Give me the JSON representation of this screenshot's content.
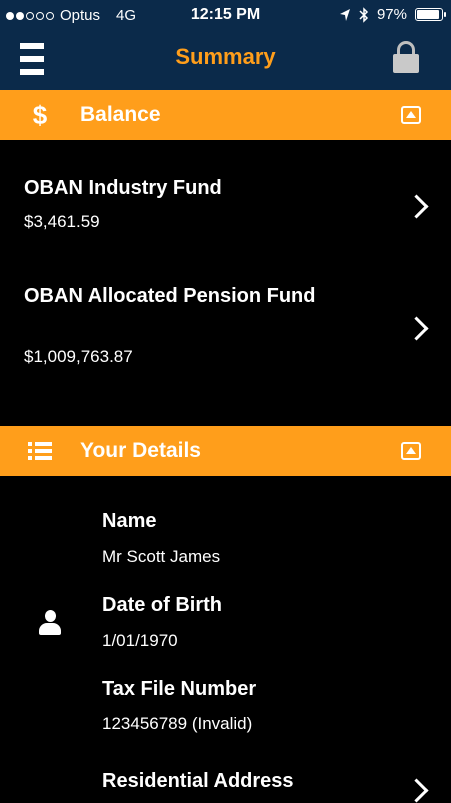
{
  "status_bar": {
    "carrier": "Optus",
    "network": "4G",
    "time": "12:15 PM",
    "battery": "97%",
    "battery_level": 0.97
  },
  "nav": {
    "title": "Summary",
    "menu_icon": "hamburger-icon",
    "lock_icon": "lock-icon"
  },
  "balance_section": {
    "title": "Balance",
    "icon": "dollar-icon",
    "funds": [
      {
        "name": "OBAN Industry Fund",
        "amount": "$3,461.59"
      },
      {
        "name": "OBAN Allocated Pension Fund",
        "amount": "$1,009,763.87"
      }
    ]
  },
  "details_section": {
    "title": "Your Details",
    "icon": "list-icon",
    "fields": [
      {
        "label": "Name",
        "value": "Mr Scott James"
      },
      {
        "label": "Date of Birth",
        "value": "1/01/1970"
      },
      {
        "label": "Tax File Number",
        "value": "123456789 (Invalid)"
      },
      {
        "label": "Residential Address"
      }
    ]
  },
  "colors": {
    "accent": "#ff9e1b",
    "nav_background": "#0b2a4a",
    "background": "#000000",
    "text": "#ffffff"
  }
}
